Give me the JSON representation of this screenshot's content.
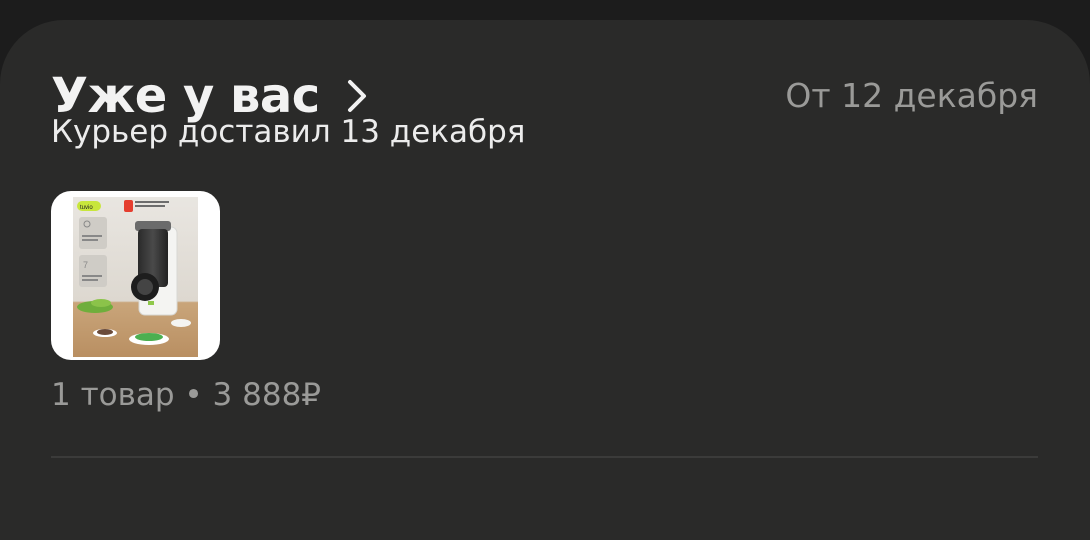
{
  "order": {
    "title": "Уже у вас",
    "date": "От 12 декабря",
    "status": "Курьер доставил 13 декабря",
    "summary": "1 товар • 3 888₽",
    "product": {
      "image_icon": "juicer-product-image",
      "brand_text": "tuvio",
      "badge_text": "Придумано в Яндекс Фабрике"
    }
  },
  "colors": {
    "background": "#1c1c1c",
    "card": "#2a2a29",
    "title": "#f2f2f2",
    "muted": "#9a9a98"
  }
}
